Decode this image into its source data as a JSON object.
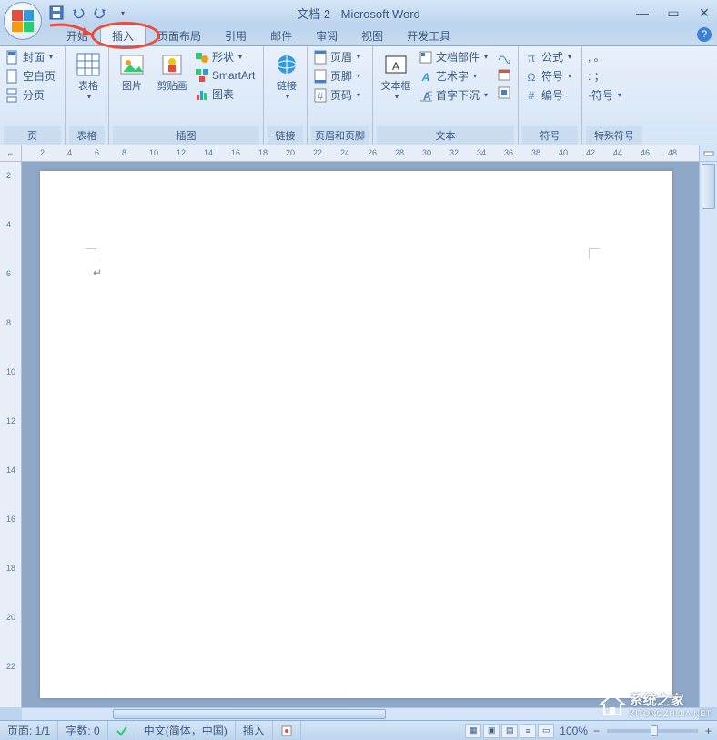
{
  "title": "文档 2 - Microsoft Word",
  "tabs": [
    "开始",
    "插入",
    "页面布局",
    "引用",
    "邮件",
    "审阅",
    "视图",
    "开发工具"
  ],
  "active_tab_index": 1,
  "ribbon": {
    "groups": [
      {
        "label": "页",
        "items_sm": [
          "封面",
          "空白页",
          "分页"
        ]
      },
      {
        "label": "表格",
        "items_lg": [
          "表格"
        ]
      },
      {
        "label": "插图",
        "items_lg": [
          "图片",
          "剪贴画"
        ],
        "items_sm": [
          "形状",
          "SmartArt",
          "图表"
        ]
      },
      {
        "label": "链接",
        "items_lg": [
          "链接"
        ]
      },
      {
        "label": "页眉和页脚",
        "items_sm": [
          "页眉",
          "页脚",
          "页码"
        ]
      },
      {
        "label": "文本",
        "items_lg": [
          "文本框"
        ],
        "items_sm": [
          "文档部件",
          "艺术字",
          "首字下沉"
        ]
      },
      {
        "label": "符号",
        "items_sm": [
          "公式",
          "符号",
          "编号"
        ]
      },
      {
        "label": "特殊符号",
        "items_sm": [
          ", 。",
          ": ；",
          "·符号"
        ]
      }
    ]
  },
  "ruler_h": [
    2,
    4,
    6,
    8,
    10,
    12,
    14,
    16,
    18,
    20,
    22,
    24,
    26,
    28,
    30,
    32,
    34,
    36,
    38,
    40,
    42,
    44,
    46,
    48
  ],
  "ruler_v": [
    2,
    4,
    6,
    8,
    10,
    12,
    14,
    16,
    18,
    20,
    22
  ],
  "status": {
    "page": "页面: 1/1",
    "words": "字数: 0",
    "lang": "中文(简体，中国)",
    "mode": "插入",
    "zoom": "100%"
  },
  "watermark": {
    "text": "系统之家",
    "url": "XITONGZHIJIA.NET"
  }
}
